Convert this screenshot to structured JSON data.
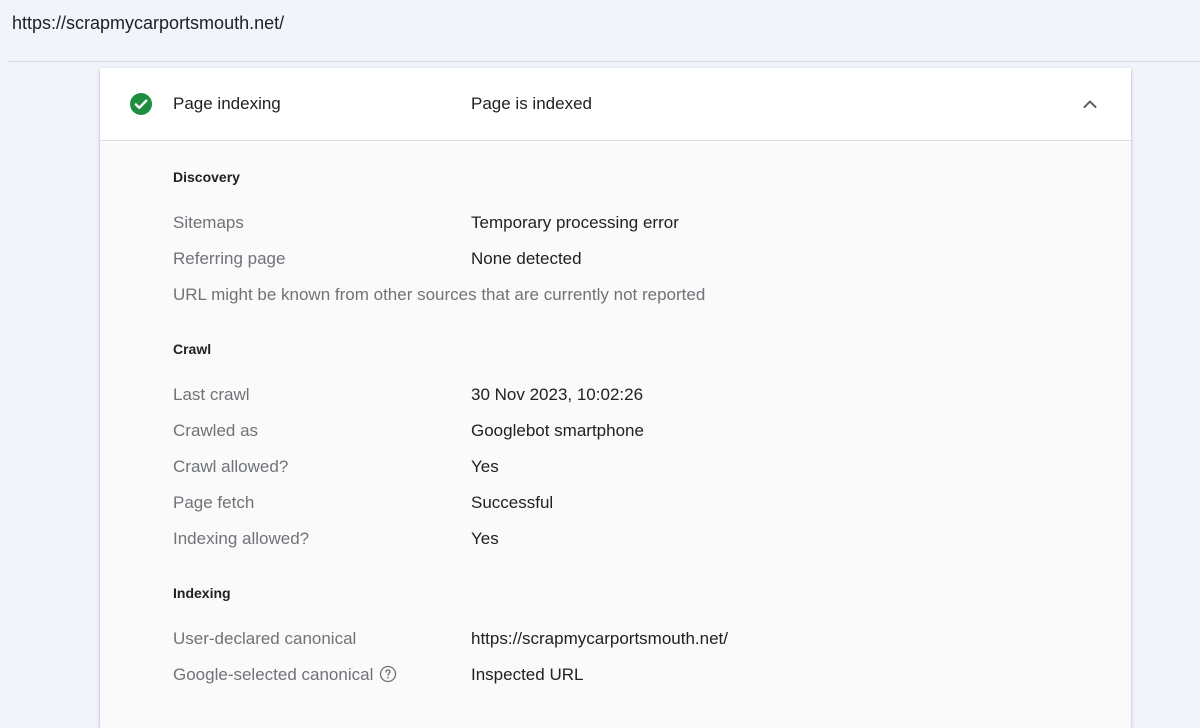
{
  "url": "https://scrapmycarportsmouth.net/",
  "header": {
    "title": "Page indexing",
    "status": "Page is indexed",
    "status_color": "#1e8e3e"
  },
  "discovery": {
    "title": "Discovery",
    "sitemaps_label": "Sitemaps",
    "sitemaps_value": "Temporary processing error",
    "referring_label": "Referring page",
    "referring_value": "None detected",
    "note": "URL might be known from other sources that are currently not reported"
  },
  "crawl": {
    "title": "Crawl",
    "last_crawl_label": "Last crawl",
    "last_crawl_value": "30 Nov 2023, 10:02:26",
    "crawled_as_label": "Crawled as",
    "crawled_as_value": "Googlebot smartphone",
    "crawl_allowed_label": "Crawl allowed?",
    "crawl_allowed_value": "Yes",
    "page_fetch_label": "Page fetch",
    "page_fetch_value": "Successful",
    "indexing_allowed_label": "Indexing allowed?",
    "indexing_allowed_value": "Yes"
  },
  "indexing": {
    "title": "Indexing",
    "user_canonical_label": "User-declared canonical",
    "user_canonical_value": "https://scrapmycarportsmouth.net/",
    "google_canonical_label": "Google-selected canonical",
    "google_canonical_value": "Inspected URL"
  },
  "icons": {
    "status": "check-circle-icon",
    "collapse": "chevron-up-icon",
    "help": "help-circle-icon"
  }
}
